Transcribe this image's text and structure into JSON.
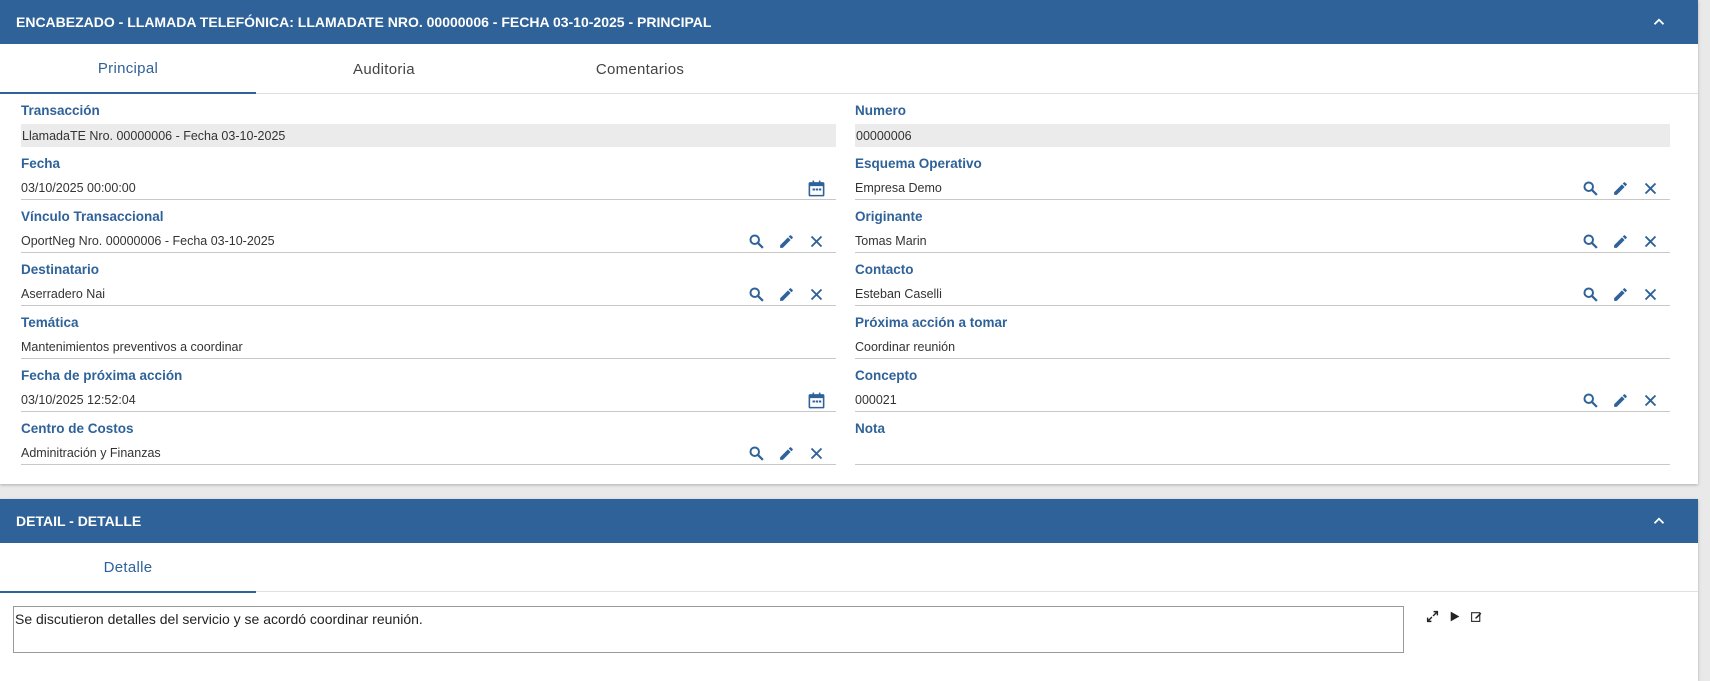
{
  "header_panel": {
    "title": "ENCABEZADO - LLAMADA TELEFÓNICA: LLAMADATE NRO. 00000006 - FECHA 03-10-2025 - PRINCIPAL",
    "tabs": [
      "Principal",
      "Auditoria",
      "Comentarios"
    ],
    "active_tab": "Principal",
    "left_fields": [
      {
        "label": "Transacción",
        "value": "LlamadaTE Nro.  00000006 - Fecha 03-10-2025"
      },
      {
        "label": "Fecha",
        "value": "03/10/2025 00:00:00"
      },
      {
        "label": "Vínculo Transaccional",
        "value": "OportNeg Nro.  00000006 - Fecha 03-10-2025"
      },
      {
        "label": "Destinatario",
        "value": "Aserradero Nai"
      },
      {
        "label": "Temática",
        "value": "Mantenimientos preventivos a coordinar"
      },
      {
        "label": "Fecha de próxima acción",
        "value": "03/10/2025 12:52:04"
      },
      {
        "label": "Centro de Costos",
        "value": "Adminitración y Finanzas"
      }
    ],
    "right_fields": [
      {
        "label": "Numero",
        "value": "00000006"
      },
      {
        "label": "Esquema Operativo",
        "value": "Empresa Demo"
      },
      {
        "label": "Originante",
        "value": "Tomas Marin"
      },
      {
        "label": "Contacto",
        "value": "Esteban Caselli"
      },
      {
        "label": "Próxima acción a tomar",
        "value": "Coordinar reunión"
      },
      {
        "label": "Concepto",
        "value": "000021"
      },
      {
        "label": "Nota",
        "value": ""
      }
    ]
  },
  "detail_panel": {
    "title": "DETAIL - DETALLE",
    "tabs": [
      "Detalle"
    ],
    "text": "Se discutieron detalles del servicio y se acordó coordinar reunión."
  },
  "colors": {
    "accent": "#2f6299",
    "bar": "#2f6299",
    "readonly_bg": "#ebebeb",
    "icon": "#2f6299"
  },
  "icons": {
    "collapse": "chevron-up-icon",
    "search": "search-icon",
    "edit": "pencil-icon",
    "clear": "close-icon",
    "calendar": "calendar-icon",
    "expand": "expand-icon",
    "play": "play-icon",
    "edit_note": "edit-note-icon"
  }
}
